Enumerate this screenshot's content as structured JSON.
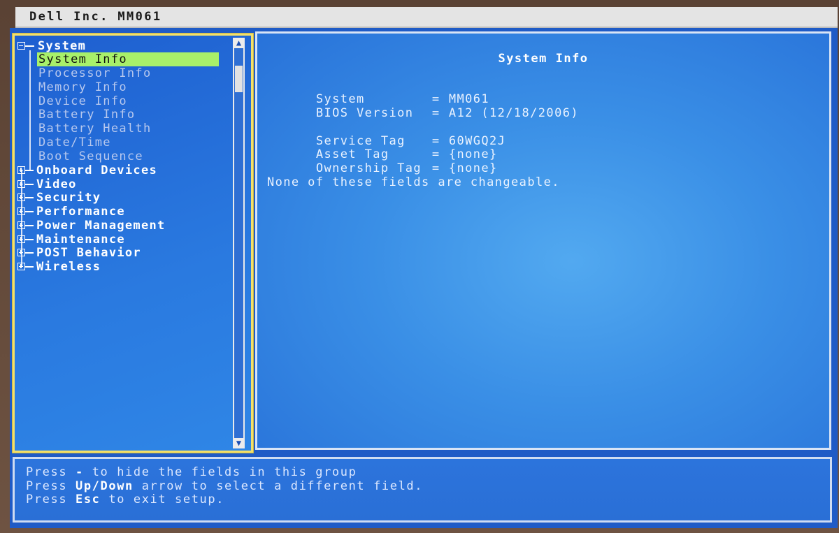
{
  "title_bar": {
    "text": "Dell Inc. MM061"
  },
  "tree": {
    "root": {
      "label": "System"
    },
    "children": [
      {
        "label": "System Info",
        "selected": true
      },
      {
        "label": "Processor Info"
      },
      {
        "label": "Memory Info"
      },
      {
        "label": "Device Info"
      },
      {
        "label": "Battery Info"
      },
      {
        "label": "Battery Health"
      },
      {
        "label": "Date/Time"
      },
      {
        "label": "Boot Sequence"
      }
    ],
    "groups": [
      {
        "label": "Onboard Devices"
      },
      {
        "label": "Video"
      },
      {
        "label": "Security"
      },
      {
        "label": "Performance"
      },
      {
        "label": "Power Management"
      },
      {
        "label": "Maintenance"
      },
      {
        "label": "POST Behavior"
      },
      {
        "label": "Wireless"
      }
    ]
  },
  "scrollbar": {
    "up_glyph": "▲",
    "down_glyph": "▼"
  },
  "info": {
    "title": "System Info",
    "fields": [
      {
        "key": "System",
        "eq": "=",
        "value": "MM061"
      },
      {
        "key": "BIOS Version",
        "eq": "=",
        "value": "A12 (12/18/2006)"
      },
      {
        "key": "Service Tag",
        "eq": "=",
        "value": "60WGQ2J"
      },
      {
        "key": "Asset Tag",
        "eq": "=",
        "value": "{none}"
      },
      {
        "key": "Ownership Tag",
        "eq": "=",
        "value": "{none}"
      }
    ],
    "note": "None of these fields are changeable."
  },
  "help": {
    "line1_pre": "Press ",
    "line1_key": "-",
    "line1_post": " to hide the fields in this group",
    "line2_pre": "Press ",
    "line2_key": "Up/Down",
    "line2_post": " arrow to select a different field.",
    "line3_pre": "Press ",
    "line3_key": "Esc",
    "line3_post": " to exit setup."
  },
  "colors": {
    "panel_blue": "#2a7ae0",
    "tree_border": "#f3e06a",
    "selection": "#a8f06a"
  }
}
